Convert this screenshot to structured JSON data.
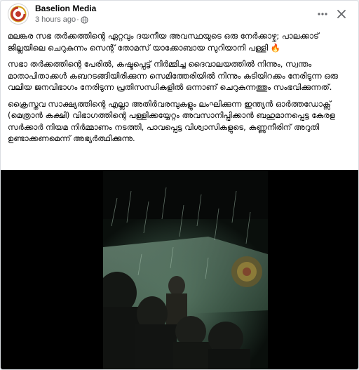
{
  "post": {
    "page_name": "Baselion Media",
    "time": "3 hours ago",
    "separator": "·",
    "privacy_icon": "globe-icon",
    "more_icon": "more-options-icon",
    "close_icon": "close-icon"
  },
  "content": {
    "paragraphs": [
      "മലങ്കര സഭ തർക്കത്തിന്റെ ഏറ്റവും ദയനീയ അവസ്ഥയുടെ ഒരു നേർക്കാഴ്ച; പാലക്കാട് ജില്ലയിലെ ചെറുകുന്നം സെന്റ് തോമസ് യാക്കോബായ സുറിയാനി പള്ളി 🔥",
      "സഭാ തർക്കത്തിന്റെ പേരിൽ, കഷ്ടപ്പെട്ട് നിർമ്മിച്ച ദൈവാലയത്തിൽ നിന്നും, സ്വന്തം മാതാപിതാക്കൾ കബറടങ്ങിയിരിക്കുന്ന സെമിത്തേരിയിൽ നിന്നും കുടിയിറക്കം നേരിടുന്ന ഒരു വലിയ ജനവിഭാഗം നേരിടുന്ന പ്രതിസന്ധികളിൽ ഒന്നാണ് ചെറുകുന്നത്തും സംഭവിക്കുന്നത്.",
      "ക്രൈസ്തവ സാക്ഷ്യത്തിന്റെ എല്ലാ അതിർവരമ്പുകളും ലംഘിക്കുന്ന ഇന്ത്യൻ ഓർത്തഡോക്സ് (മെത്രാൻ കക്ഷി) വിഭാഗത്തിന്റെ പള്ളിക്കയ്യേറ്റം അവസാനിപ്പിക്കാൻ ബഹുമാനപ്പെട്ട കേരള സർക്കാർ നിയമ നിർമ്മാണം നടത്തി, പാവപ്പെട്ട വിശ്വാസികളുടെ, കണ്ണുനീരിന് അറുതി ഉണ്ടാക്കണമെന്ന് അഭ്യർത്ഥിക്കുന്നു."
    ]
  },
  "media": {
    "type": "video"
  },
  "colors": {
    "name": "#050505",
    "meta": "#65676b",
    "card_bg": "#ffffff",
    "page_bg": "#f0f2f5",
    "logo_red": "#c0392b",
    "logo_gold": "#d4a017"
  }
}
